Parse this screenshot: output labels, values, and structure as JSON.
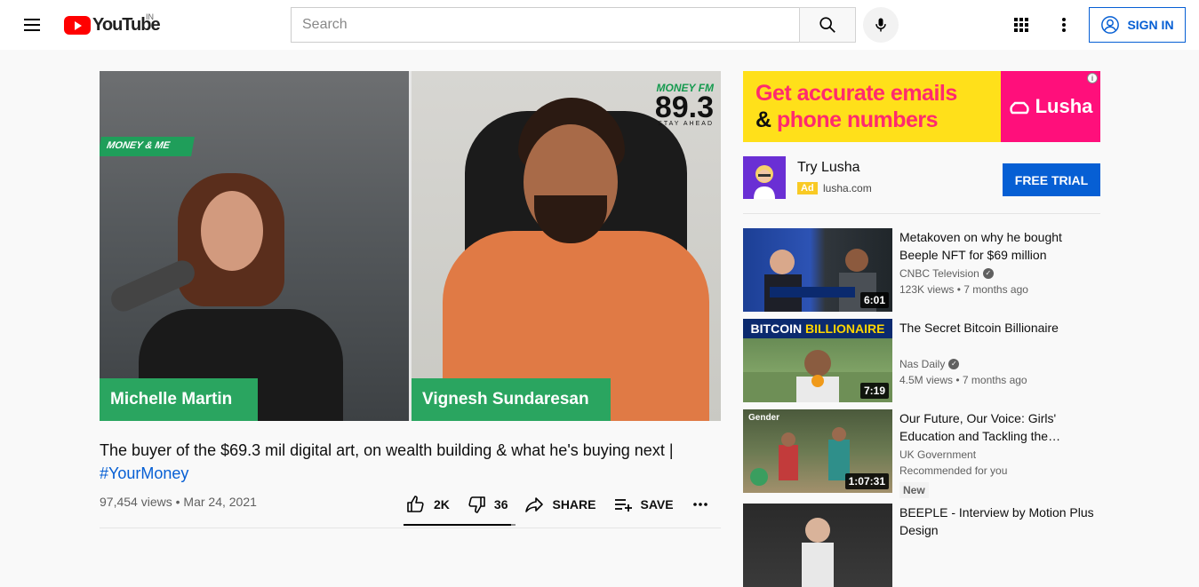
{
  "header": {
    "logo_text": "YouTube",
    "country_code": "IN",
    "search_placeholder": "Search",
    "signin_label": "SIGN IN"
  },
  "video": {
    "overlay_tag": "MONEY & ME",
    "station_brand": "MONEY FM",
    "station_freq": "89.3",
    "station_tagline": "STAY AHEAD",
    "left_name": "Michelle Martin",
    "right_name": "Vignesh Sundaresan"
  },
  "title": {
    "text": "The buyer of the $69.3 mil digital art, on wealth building & what he's buying next |",
    "hashtag": "#YourMoney"
  },
  "meta": {
    "views": "97,454 views",
    "date": "Mar 24, 2021"
  },
  "actions": {
    "likes": "2K",
    "dislikes": "36",
    "share_label": "SHARE",
    "save_label": "SAVE",
    "like_ratio": 0.96
  },
  "ad": {
    "banner_line1": "Get accurate emails",
    "banner_line2_amp": "&",
    "banner_line2": "phone numbers",
    "banner_brand": "Lusha",
    "info_icon": "info-icon",
    "title": "Try Lusha",
    "badge": "Ad",
    "domain": "lusha.com",
    "cta": "FREE TRIAL",
    "colors": {
      "banner_bg": "#ffe01a",
      "brand_pink": "#ff0f7b",
      "cta": "#065fd4"
    }
  },
  "recommendations": [
    {
      "title": "Metakoven on why he bought Beeple NFT for $69 million",
      "channel": "CNBC Television",
      "verified": true,
      "stats": "123K views • 7 months ago",
      "duration": "6:01"
    },
    {
      "title": "The Secret Bitcoin Billionaire",
      "channel": "Nas Daily",
      "verified": true,
      "stats": "4.5M views • 7 months ago",
      "duration": "7:19",
      "thumb_text_a": "BITCOIN",
      "thumb_text_b": "BILLIONAIRE"
    },
    {
      "title": "Our Future, Our Voice: Girls' Education and Tackling the…",
      "channel": "UK Government",
      "verified": false,
      "stats": "Recommended for you",
      "duration": "1:07:31",
      "badge": "New",
      "thumb_text": "Gender"
    },
    {
      "title": "BEEPLE - Interview by Motion Plus Design",
      "channel": "",
      "verified": false,
      "stats": "",
      "duration": ""
    }
  ]
}
